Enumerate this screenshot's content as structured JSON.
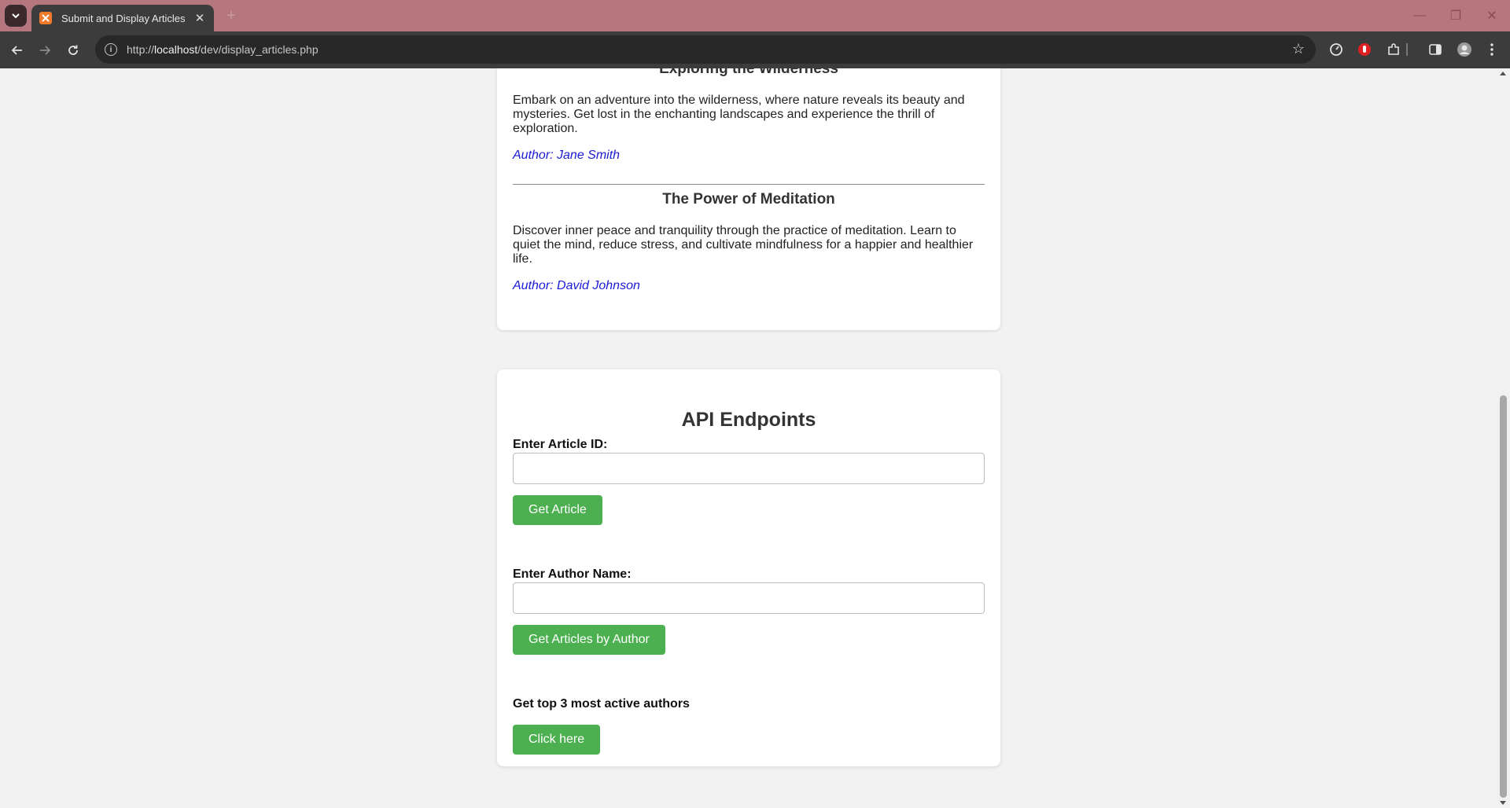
{
  "browser": {
    "tab_title": "Submit and Display Articles",
    "new_tab": "+",
    "url_prefix": "http://",
    "url_host": "localhost",
    "url_path": "/dev/display_articles.php"
  },
  "articles": [
    {
      "title": "Exploring the Wilderness",
      "body": "Embark on an adventure into the wilderness, where nature reveals its beauty and mysteries. Get lost in the enchanting landscapes and experience the thrill of exploration.",
      "author": "Author: Jane Smith"
    },
    {
      "title": "The Power of Meditation",
      "body": "Discover inner peace and tranquility through the practice of meditation. Learn to quiet the mind, reduce stress, and cultivate mindfulness for a happier and healthier life.",
      "author": "Author: David Johnson"
    }
  ],
  "api": {
    "heading": "API Endpoints",
    "article_id_label": "Enter Article ID:",
    "article_id_value": "",
    "get_article_button": "Get Article",
    "author_name_label": "Enter Author Name:",
    "author_name_value": "",
    "get_by_author_button": "Get Articles by Author",
    "top_authors_label": "Get top 3 most active authors",
    "click_here_button": "Click here"
  },
  "colors": {
    "tabstrip": "#b5767d",
    "toolbar": "#3c3c3c",
    "button_green": "#4caf50",
    "author_link": "#1a1ad6",
    "page_bg": "#f2f2f2"
  }
}
